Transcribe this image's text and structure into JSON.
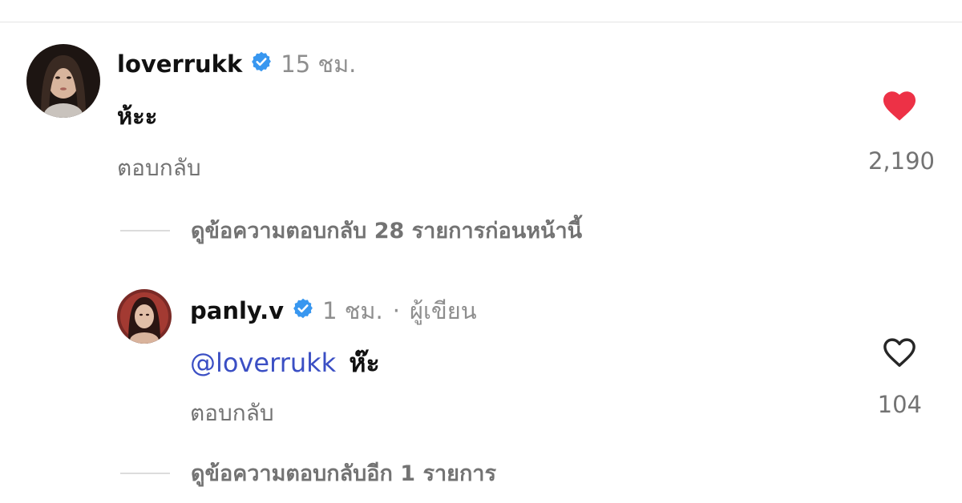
{
  "comments": [
    {
      "username": "loverrukk",
      "time": "15 ชม.",
      "text": "ห้ะะ",
      "reply_label": "ตอบกลับ",
      "like_count": "2,190",
      "liked": true,
      "view_replies": "ดูข้อความตอบกลับ 28 รายการก่อนหน้านี้"
    },
    {
      "username": "panly.v",
      "time": "1 ชม.",
      "separator": "·",
      "author_badge": "ผู้เขียน",
      "mention": "@loverrukk",
      "text": "ห๊ะ",
      "reply_label": "ตอบกลับ",
      "like_count": "104",
      "liked": false,
      "view_replies": "ดูข้อความตอบกลับอีก 1 รายการ"
    }
  ],
  "colors": {
    "verified": "#3897f0",
    "like_active": "#ed3146",
    "mention": "#3b4fc4",
    "secondary_text": "#737373"
  }
}
